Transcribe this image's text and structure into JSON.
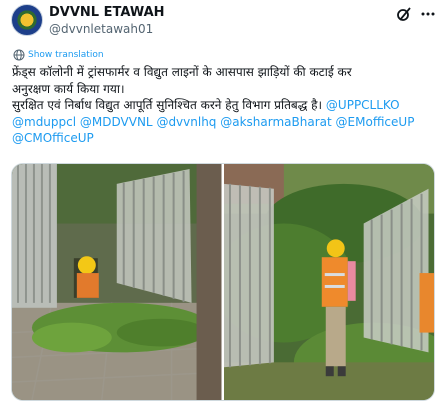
{
  "account": {
    "name": "DVVNL ETAWAH",
    "handle": "@dvvnletawah01"
  },
  "translate": {
    "label": "Show translation"
  },
  "tweet": {
    "line1": "फ्रेंड्स कॉलोनी में ट्रांसफार्मर व विद्युत लाइनों के आसपास झाड़ियों की कटाई कर",
    "line2": "अनुरक्षण कार्य किया गया।",
    "line3_text": "सुरक्षित एवं निर्बाध विद्युत आपूर्ति सुनिश्चित करने हेतु विभाग प्रतिबद्ध है। ",
    "mentions": [
      "@UPPCLLKO",
      "@mduppcl",
      "@MDDVVNL",
      "@dvvnlhq",
      "@aksharmaBharat",
      "@EMofficeUP",
      "@CMOfficeUP"
    ]
  },
  "icons": {
    "avatar": "dvvnl-logo",
    "header_action": "grok-slash-icon",
    "menu": "more-icon",
    "translate": "globe-icon"
  },
  "colors": {
    "link": "#1d9bf0",
    "text": "#0f1419",
    "secondary": "#536471",
    "border": "#cfd9de"
  }
}
